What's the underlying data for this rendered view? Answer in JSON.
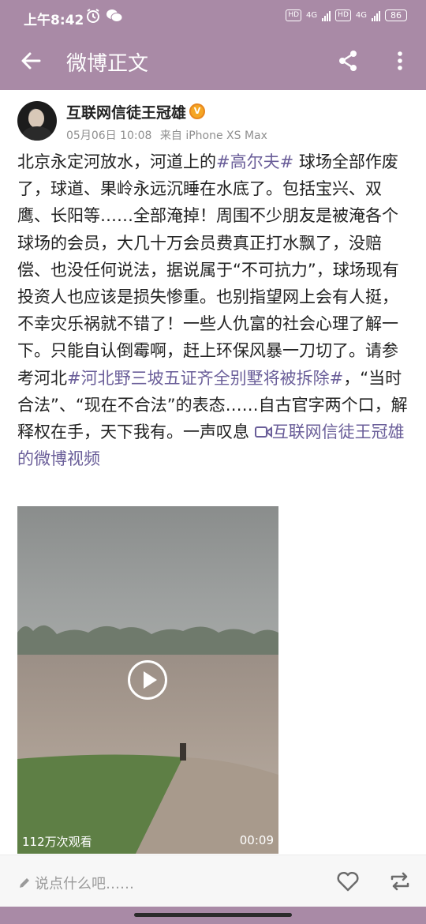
{
  "status_bar": {
    "time": "上午8:42",
    "hd1": "HD",
    "hd2": "HD",
    "net1": "4G",
    "net2": "4G",
    "battery": "86"
  },
  "app_bar": {
    "title": "微博正文"
  },
  "post": {
    "username": "互联网信徒王冠雄",
    "verified_badge": "V",
    "date": "05月06日 10:08",
    "source": "来自 iPhone XS Max",
    "text_1": "北京永定河放水，河道上的",
    "tag_1": "#高尔夫#",
    "text_2": " 球场全部作废了，球道、果岭永远沉睡在水底了。包括宝兴、双鹰、长阳等……全部淹掉！周围不少朋友是被淹各个球场的会员，大几十万会员费真正打水飘了，没赔偿、也没任何说法，据说属于“不可抗力”，球场现有投资人也应该是损失惨重。也别指望网上会有人挺，不幸灾乐祸就不错了！一些人仇富的社会心理了解一下。只能自认倒霉啊，赶上环保风暴一刀切了。请参考河北",
    "tag_2": "#河北野三坡五证齐全别墅将被拆除#",
    "text_3": "，“当时合法”、“现在不合法”的表态……自古官字两个口，解释权在手，天下我有。一声叹息 ",
    "video_link": "互联网信徒王冠雄的微博视频"
  },
  "video": {
    "views": "112万次观看",
    "duration": "00:09"
  },
  "bottom_bar": {
    "comment_placeholder": "说点什么吧……"
  },
  "colors": {
    "bar": "#a98aa6",
    "tag": "#6a5e99",
    "badge": "#f5a623"
  }
}
